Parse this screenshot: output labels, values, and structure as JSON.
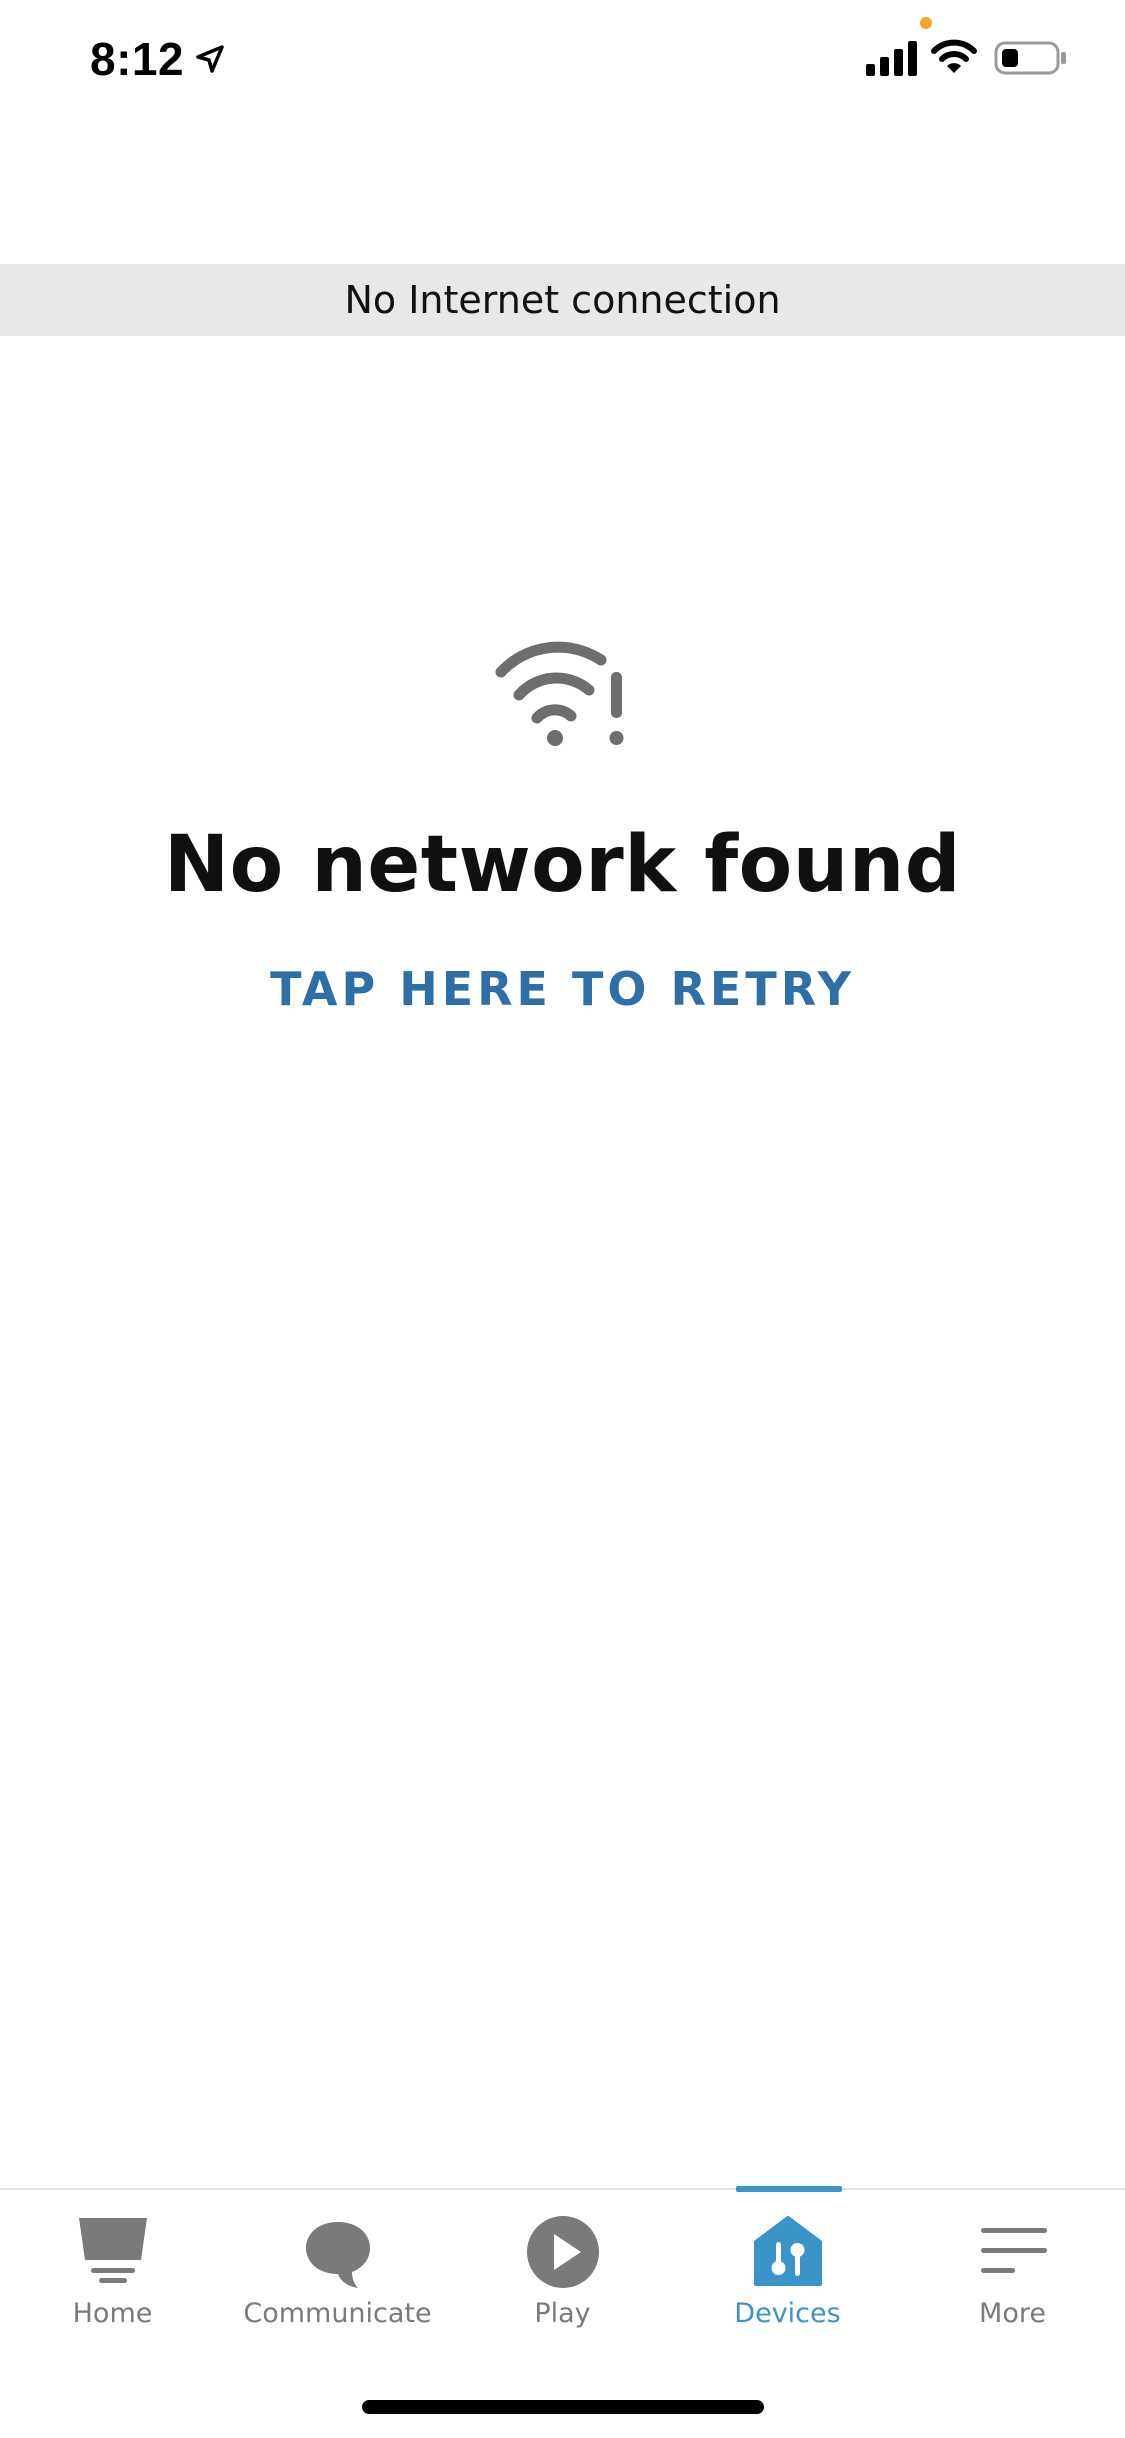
{
  "status_bar": {
    "time": "8:12"
  },
  "banner": {
    "text": "No Internet connection"
  },
  "empty_state": {
    "icon": "wifi-alert-icon",
    "title": "No network found",
    "action": "TAP HERE TO RETRY"
  },
  "tab_bar": {
    "active": "Devices",
    "accent_color": "#3a94c8",
    "inactive_color": "#7a7a7a",
    "tabs": [
      {
        "label": "Home",
        "icon": "home-icon"
      },
      {
        "label": "Communicate",
        "icon": "speech-bubble-icon"
      },
      {
        "label": "Play",
        "icon": "play-icon"
      },
      {
        "label": "Devices",
        "icon": "devices-house-icon"
      },
      {
        "label": "More",
        "icon": "menu-icon"
      }
    ]
  }
}
